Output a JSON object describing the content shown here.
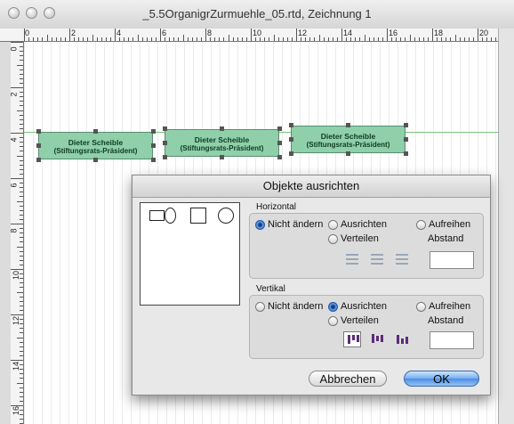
{
  "window": {
    "title": "_5.5OrganigrZurmuehle_05.rtd, Zeichnung 1"
  },
  "ruler": {
    "horizontal_labels": [
      "0",
      "2",
      "4",
      "6",
      "8",
      "10",
      "12",
      "14",
      "16",
      "18",
      "20"
    ],
    "vertical_labels": [
      "0",
      "2",
      "4",
      "6",
      "8",
      "10",
      "12",
      "14",
      "16"
    ]
  },
  "shapes": [
    {
      "name": "Dieter Scheible",
      "role": "(Stiftungsrats-Präsident)"
    },
    {
      "name": "Dieter Scheible",
      "role": "(Stiftungsrats-Präsident)"
    },
    {
      "name": "Dieter Scheible",
      "role": "(Stiftungsrats-Präsident)"
    }
  ],
  "dialog": {
    "title": "Objekte ausrichten",
    "horizontal": {
      "label": "Horizontal",
      "options": [
        "Nicht ändern",
        "Ausrichten",
        "Aufreihen",
        "Verteilen"
      ],
      "selected": "Nicht ändern",
      "spacing_label": "Abstand",
      "spacing_value": ""
    },
    "vertical": {
      "label": "Vertikal",
      "options": [
        "Nicht ändern",
        "Ausrichten",
        "Aufreihen",
        "Verteilen"
      ],
      "selected": "Ausrichten",
      "spacing_label": "Abstand",
      "spacing_value": ""
    },
    "cancel_label": "Abbrechen",
    "ok_label": "OK"
  },
  "colors": {
    "shape_fill": "#8fcfaa",
    "guide_line": "#79c279",
    "ok_button": "#5b9be6",
    "vertical_icon": "#5c2c7a"
  }
}
